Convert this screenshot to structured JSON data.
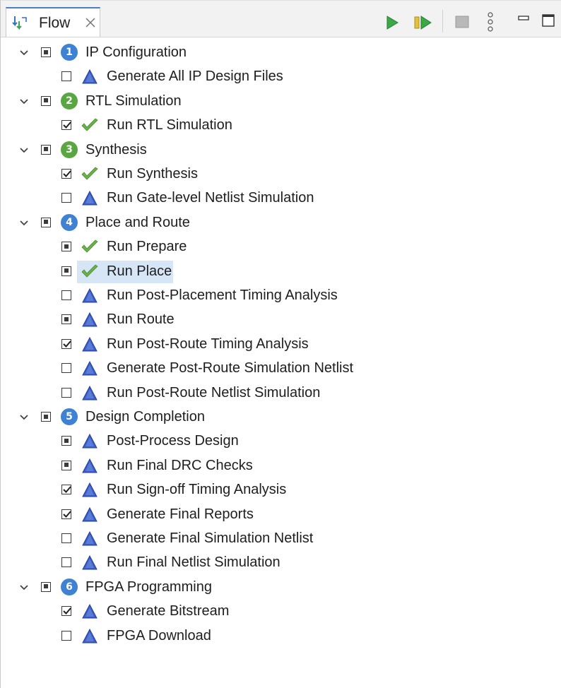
{
  "view_tab": {
    "label": "Flow",
    "icon": "flow-icon"
  },
  "toolbar": {
    "buttons": [
      "run-icon",
      "run-all-icon",
      "stop-icon",
      "view-menu-icon",
      "minimize-icon",
      "maximize-icon"
    ]
  },
  "colors": {
    "accent": "#4a7fc8",
    "check": "#6ab04c",
    "triangle": "#3b5fc8",
    "selection": "#d7e6f7",
    "step_blue": "#3f82d3",
    "step_green": "#5aa640"
  },
  "steps": [
    {
      "number": "1",
      "label": "IP Configuration",
      "badge_color": "#3f82d3",
      "checkbox": "partial",
      "tasks": [
        {
          "label": "Generate All IP Design Files",
          "checkbox": "unchecked",
          "status": "pending"
        }
      ]
    },
    {
      "number": "2",
      "label": "RTL Simulation",
      "badge_color": "#5aa640",
      "checkbox": "partial",
      "tasks": [
        {
          "label": "Run RTL Simulation",
          "checkbox": "checked",
          "status": "done"
        }
      ]
    },
    {
      "number": "3",
      "label": "Synthesis",
      "badge_color": "#5aa640",
      "checkbox": "partial",
      "tasks": [
        {
          "label": "Run Synthesis",
          "checkbox": "checked",
          "status": "done"
        },
        {
          "label": "Run Gate-level Netlist Simulation",
          "checkbox": "unchecked",
          "status": "pending"
        }
      ]
    },
    {
      "number": "4",
      "label": "Place and Route",
      "badge_color": "#3f82d3",
      "checkbox": "partial",
      "tasks": [
        {
          "label": "Run Prepare",
          "checkbox": "partial",
          "status": "done"
        },
        {
          "label": "Run Place",
          "checkbox": "partial",
          "status": "done",
          "selected": true
        },
        {
          "label": "Run Post-Placement Timing Analysis",
          "checkbox": "unchecked",
          "status": "pending"
        },
        {
          "label": "Run Route",
          "checkbox": "partial",
          "status": "pending"
        },
        {
          "label": "Run Post-Route Timing Analysis",
          "checkbox": "checked",
          "status": "pending"
        },
        {
          "label": "Generate Post-Route Simulation Netlist",
          "checkbox": "unchecked",
          "status": "pending"
        },
        {
          "label": "Run Post-Route Netlist Simulation",
          "checkbox": "unchecked",
          "status": "pending"
        }
      ]
    },
    {
      "number": "5",
      "label": "Design Completion",
      "badge_color": "#3f82d3",
      "checkbox": "partial",
      "tasks": [
        {
          "label": "Post-Process Design",
          "checkbox": "partial",
          "status": "pending"
        },
        {
          "label": "Run Final DRC Checks",
          "checkbox": "partial",
          "status": "pending"
        },
        {
          "label": "Run Sign-off Timing Analysis",
          "checkbox": "checked",
          "status": "pending"
        },
        {
          "label": "Generate Final Reports",
          "checkbox": "checked",
          "status": "pending"
        },
        {
          "label": "Generate Final Simulation Netlist",
          "checkbox": "unchecked",
          "status": "pending"
        },
        {
          "label": "Run Final Netlist Simulation",
          "checkbox": "unchecked",
          "status": "pending"
        }
      ]
    },
    {
      "number": "6",
      "label": "FPGA Programming",
      "badge_color": "#3f82d3",
      "checkbox": "partial",
      "tasks": [
        {
          "label": "Generate Bitstream",
          "checkbox": "checked",
          "status": "pending"
        },
        {
          "label": "FPGA Download",
          "checkbox": "unchecked",
          "status": "pending"
        }
      ]
    }
  ]
}
